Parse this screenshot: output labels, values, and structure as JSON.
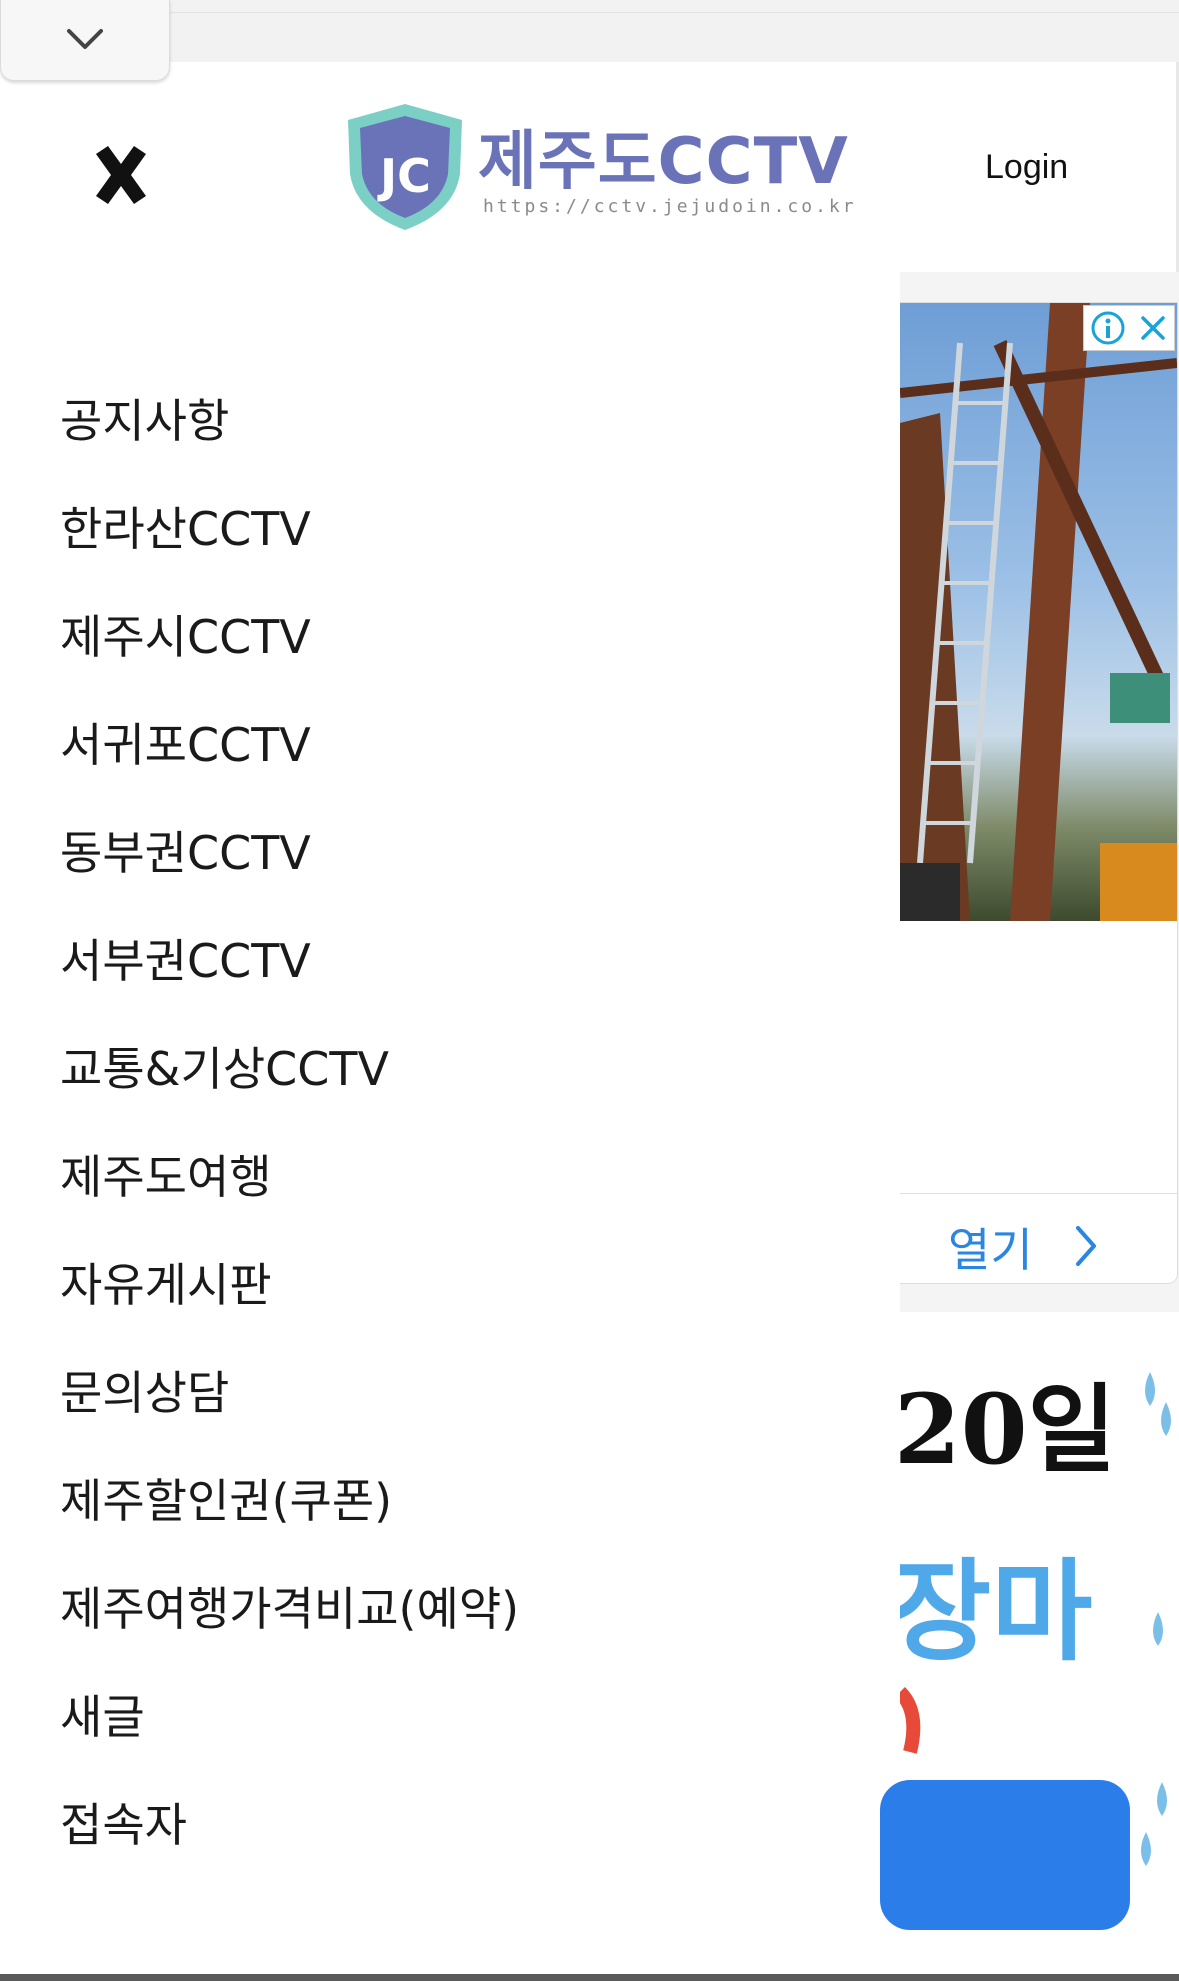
{
  "header": {
    "logo_title": "제주도CCTV",
    "logo_url": "https://cctv.jejudoin.co.kr",
    "logo_mark": "JC",
    "login_label": "Login"
  },
  "menu": {
    "items": [
      {
        "label": "공지사항"
      },
      {
        "label": "한라산CCTV"
      },
      {
        "label": "제주시CCTV"
      },
      {
        "label": "서귀포CCTV"
      },
      {
        "label": "동부권CCTV"
      },
      {
        "label": "서부권CCTV"
      },
      {
        "label": "교통&기상CCTV"
      },
      {
        "label": "제주도여행"
      },
      {
        "label": "자유게시판"
      },
      {
        "label": "문의상담"
      },
      {
        "label": "제주할인권(쿠폰)"
      },
      {
        "label": "제주여행가격비교(예약)"
      },
      {
        "label": "새글"
      },
      {
        "label": "접속자"
      }
    ]
  },
  "ad": {
    "open_label": "열기",
    "banner_text_1": "20일",
    "banner_text_2": "장마",
    "accent": "#2a86e0"
  },
  "icons": {
    "collapse": "chevron-down-icon",
    "close": "close-x-icon",
    "ad_info": "info-icon",
    "ad_close": "close-icon",
    "open_chevron": "chevron-right-icon"
  }
}
